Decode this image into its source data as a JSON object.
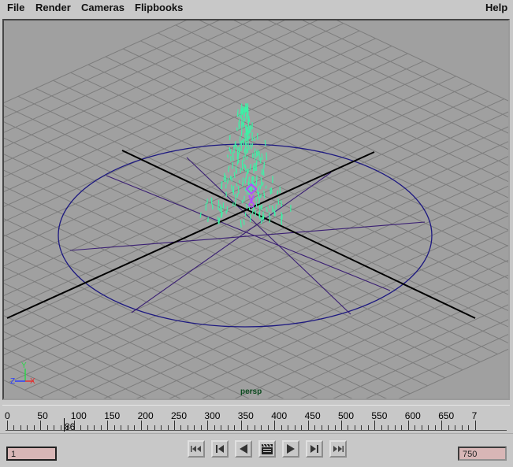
{
  "menubar": {
    "items": [
      "File",
      "Render",
      "Cameras",
      "Flipbooks"
    ],
    "help": "Help"
  },
  "viewport": {
    "camera_label": "persp",
    "axis_labels": {
      "y": "Y",
      "z": "Z",
      "x": "X"
    },
    "colors": {
      "background": "#a0a0a0",
      "grid": "#7d7d7d",
      "axis": "#000000",
      "circle": "#1c1880",
      "particles": "#3cf2a6",
      "emitter": "#b44cff",
      "camera_label": "#0b4a1e"
    }
  },
  "timeline": {
    "ticks": [
      "0",
      "50",
      "100",
      "150",
      "200",
      "250",
      "300",
      "350",
      "400",
      "450",
      "500",
      "550",
      "600",
      "650",
      "7"
    ],
    "current_frame": "86"
  },
  "playback": {
    "start_frame": "1",
    "end_frame": "750",
    "buttons": [
      {
        "name": "go-to-start-button",
        "icon": "go-to-start-icon"
      },
      {
        "name": "step-back-key-button",
        "icon": "step-back-key-icon"
      },
      {
        "name": "play-backwards-button",
        "icon": "play-backwards-icon"
      },
      {
        "name": "playblast-button",
        "icon": "clapperboard-icon"
      },
      {
        "name": "play-forwards-button",
        "icon": "play-forwards-icon"
      },
      {
        "name": "step-forward-key-button",
        "icon": "step-forward-key-icon"
      },
      {
        "name": "go-to-end-button",
        "icon": "go-to-end-icon"
      }
    ]
  }
}
